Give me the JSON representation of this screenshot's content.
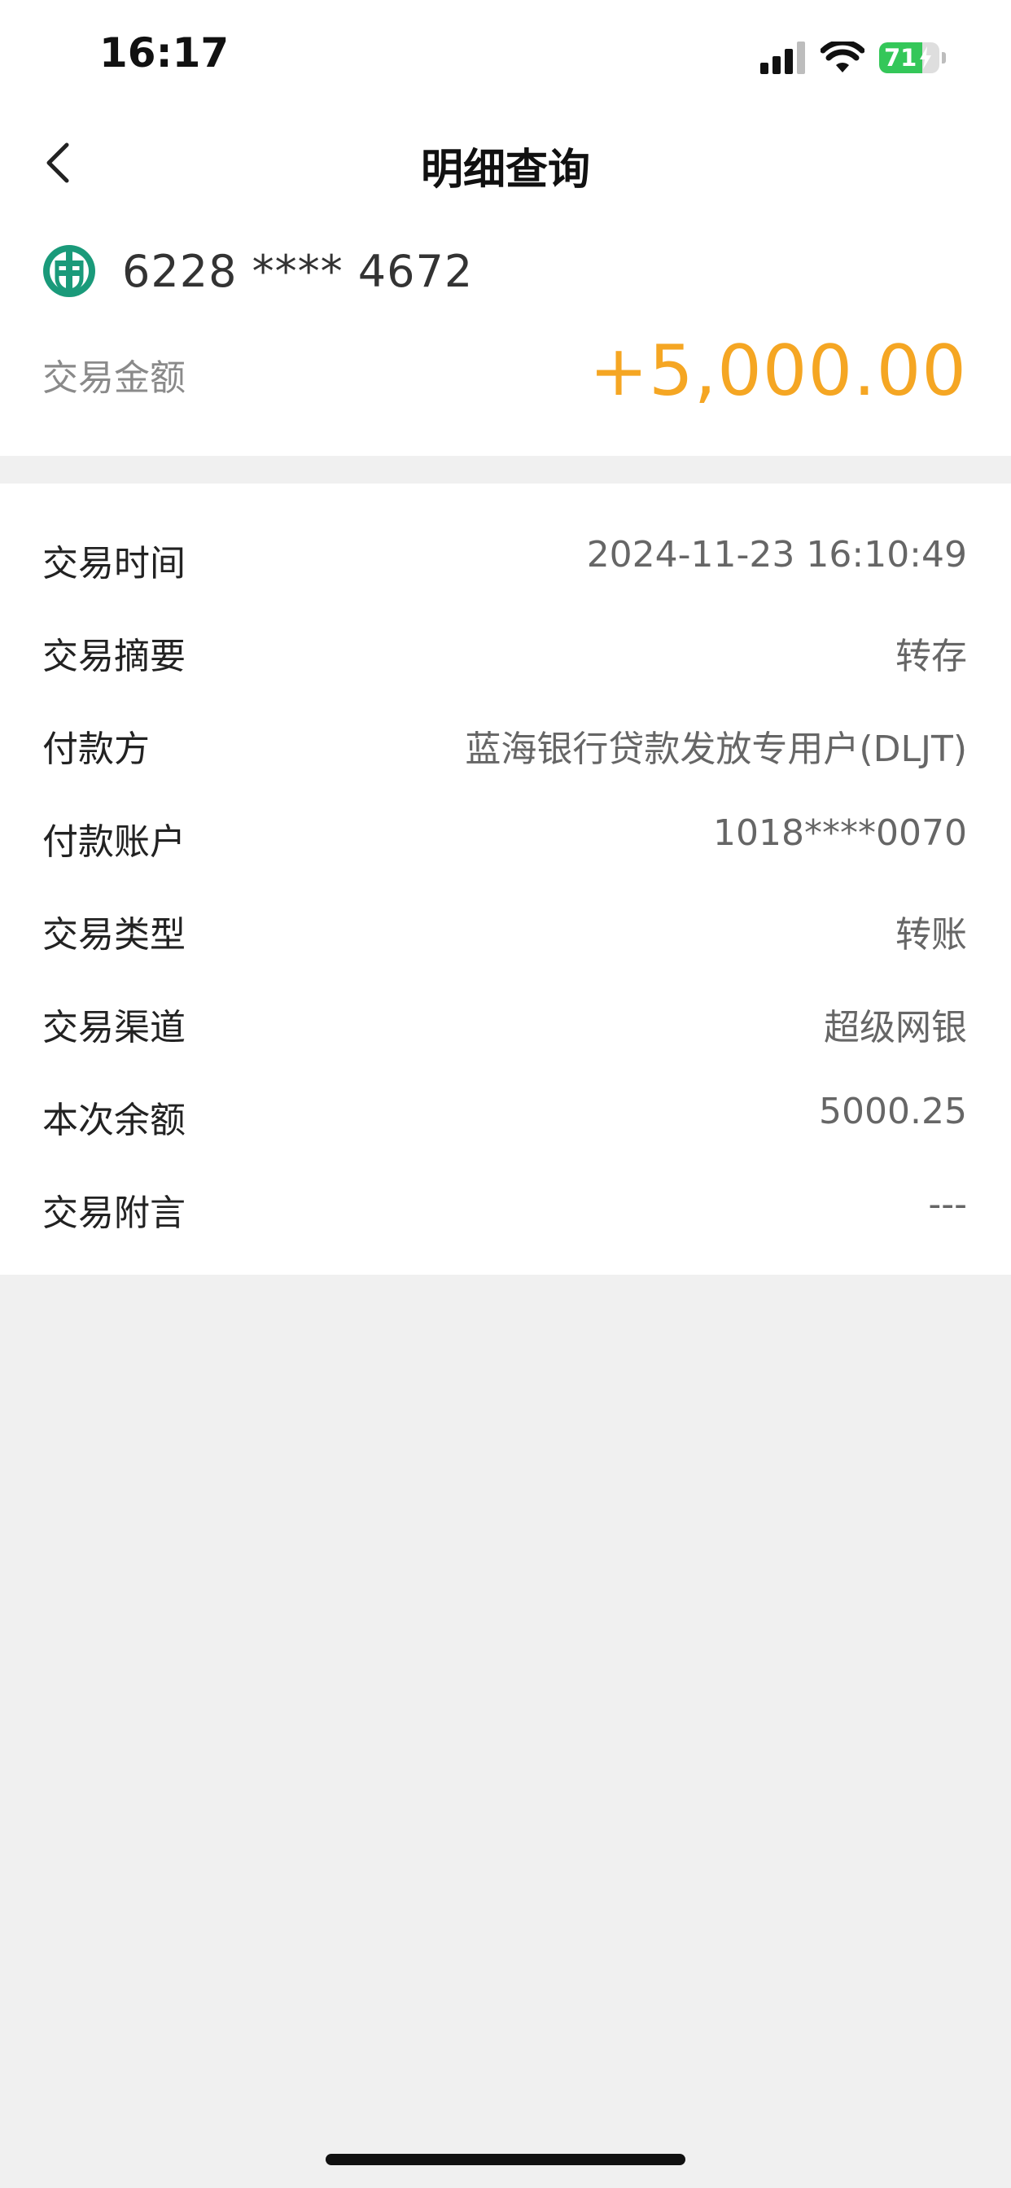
{
  "status_bar": {
    "time": "16:17",
    "battery_percent": "71",
    "battery_level": 0.71,
    "signal_icon": "cellular-signal-icon",
    "wifi_icon": "wifi-icon",
    "battery_icon": "battery-charging-icon"
  },
  "nav": {
    "back_icon": "chevron-left-icon",
    "title": "明细查询"
  },
  "account": {
    "bank_logo_icon": "bank-logo-icon",
    "card_number": "6228 **** 4672",
    "amount_label": "交易金额",
    "amount_value": "+5,000.00",
    "amount_color": "#f5a623"
  },
  "details": [
    {
      "label": "交易时间",
      "value": "2024-11-23 16:10:49"
    },
    {
      "label": "交易摘要",
      "value": "转存"
    },
    {
      "label": "付款方",
      "value": "蓝海银行贷款发放专用户(DLJT)"
    },
    {
      "label": "付款账户",
      "value": "1018****0070"
    },
    {
      "label": "交易类型",
      "value": "转账"
    },
    {
      "label": "交易渠道",
      "value": "超级网银"
    },
    {
      "label": "本次余额",
      "value": "5000.25"
    },
    {
      "label": "交易附言",
      "value": "---"
    }
  ],
  "colors": {
    "brand_logo": "#1a9a7a",
    "accent_amount": "#f5a623",
    "battery_green": "#34c759"
  }
}
